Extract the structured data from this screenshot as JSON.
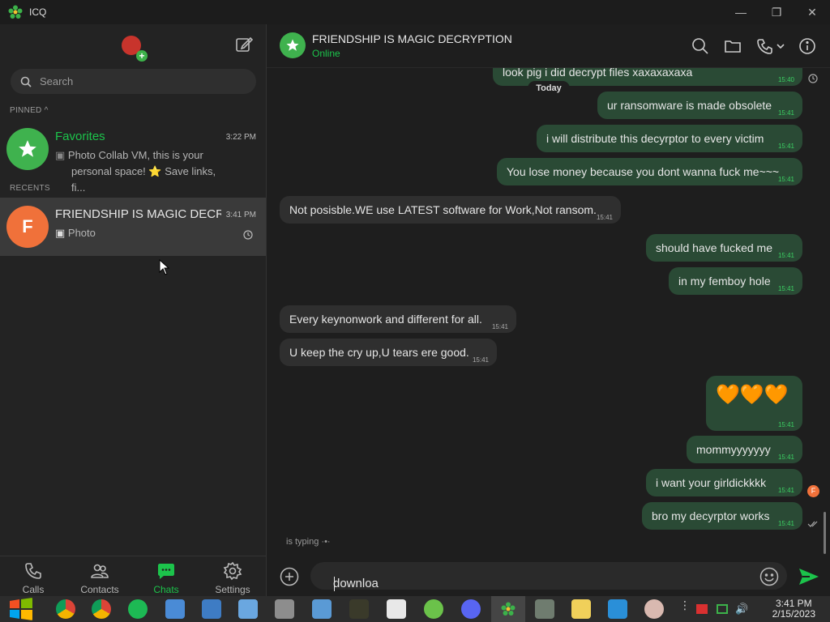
{
  "app": {
    "title": "ICQ",
    "accent": "#1cc34b"
  },
  "window_controls": {
    "minimize": "—",
    "maximize": "❐",
    "close": "✕"
  },
  "sidebar": {
    "search_placeholder": "Search",
    "pinned_label": "PINNED ^",
    "recents_label": "RECENTS",
    "chats": [
      {
        "name": "Favorites",
        "time": "3:22 PM",
        "preview_line1": "Photo Collab VM, this is your",
        "preview_line2": "personal space! ⭐ Save links, fi...",
        "icon": "star-icon",
        "color": "#3fb24e"
      },
      {
        "name": "FRIENDSHIP IS MAGIC DECRY...",
        "time": "3:41 PM",
        "preview": "Photo",
        "avatar_letter": "F",
        "color": "#f0713a"
      }
    ]
  },
  "nav": {
    "calls": "Calls",
    "contacts": "Contacts",
    "chats": "Chats",
    "settings": "Settings"
  },
  "chat": {
    "name": "FRIENDSHIP IS MAGIC DECRYPTION",
    "status": "Online",
    "day_separator": "Today",
    "typing": "is typing ·•·",
    "messages": [
      {
        "dir": "out",
        "text": "look pig i did decrypt files xaxaxaxaxa",
        "time": "15:40"
      },
      {
        "dir": "out",
        "text": "ur ransomware is made obsolete",
        "time": "15:41"
      },
      {
        "dir": "out",
        "text": "i will distribute this decyrptor to every victim",
        "time": "15:41"
      },
      {
        "dir": "out",
        "text": "You lose money because you dont wanna fuck me~~~",
        "time": "15:41"
      },
      {
        "dir": "in",
        "text": "Not posisble.WE use LATEST software for Work,Not ransom.",
        "time": "15:41"
      },
      {
        "dir": "out",
        "text": "should have fucked me",
        "time": "15:41"
      },
      {
        "dir": "out",
        "text": "in my femboy hole",
        "time": "15:41"
      },
      {
        "dir": "in",
        "text": "Every keynonwork and different for all.",
        "time": "15:41"
      },
      {
        "dir": "in",
        "text": "U keep the cry up,U tears ere good.",
        "time": "15:41"
      },
      {
        "dir": "out",
        "text": "🧡🧡🧡",
        "time": "15:41"
      },
      {
        "dir": "out",
        "text": "mommyyyyyyy",
        "time": "15:41"
      },
      {
        "dir": "out",
        "text": "i want your girldickkkk",
        "time": "15:41"
      },
      {
        "dir": "out",
        "text": "bro my decyrptor works",
        "time": "15:41"
      }
    ],
    "composer_value": "downloa"
  },
  "taskbar": {
    "time": "3:41 PM",
    "date": "2/15/2023"
  }
}
